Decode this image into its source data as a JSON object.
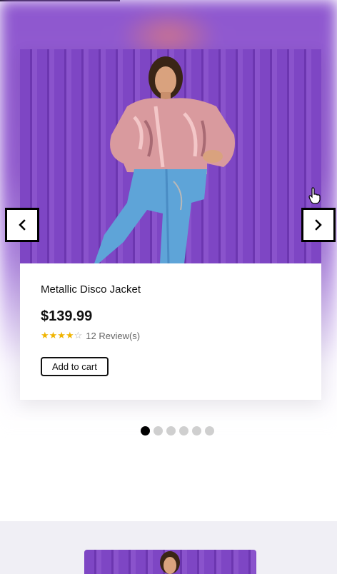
{
  "product": {
    "name": "Metallic Disco Jacket",
    "price": "$139.99",
    "stars_filled": "★★★★",
    "stars_empty": "☆",
    "rating": 4,
    "rating_max": 5,
    "reviews": "12 Review(s)",
    "add_to_cart": "Add to cart",
    "image_icon": "fashion-model-photo"
  },
  "carousel": {
    "prev_icon": "chevron-left-icon",
    "next_icon": "chevron-right-icon",
    "slide_count": 6,
    "active_slide": 1
  },
  "colors": {
    "accent_purple": "#7e46c4",
    "star": "#f0b400",
    "dot_active": "#000000",
    "dot_inactive": "#cfcfcf"
  }
}
